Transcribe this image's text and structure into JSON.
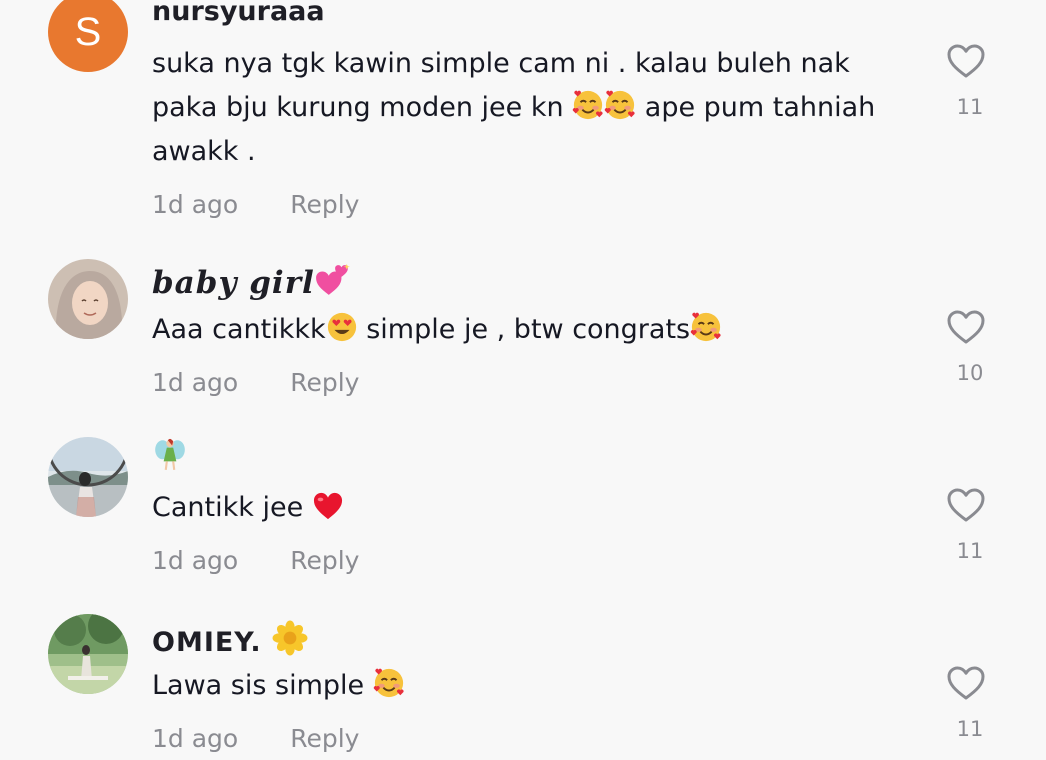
{
  "colors": {
    "background": "#f8f8f8",
    "text": "#161823",
    "muted": "#8a8b91",
    "avatar_letter_bg": "#e8782f"
  },
  "comments": [
    {
      "avatar_letter": "S",
      "username": "nursyuraaa",
      "text_line1": "suka nya tgk kawin simple cam ni . kalau buleh nak",
      "text_line2a": "paka bju kurung moden jee kn ",
      "text_line2b": " ape pum tahniah",
      "text_line3": "awakk .",
      "time": "1d ago",
      "reply": "Reply",
      "likes": "11",
      "icons": [
        "smiling-face-with-hearts-icon",
        "smiling-face-with-hearts-icon"
      ]
    },
    {
      "avatar": "profile-photo-hijab",
      "username": "baby girl",
      "username_icon": "two-hearts-icon",
      "text_a": "Aaa cantikkk",
      "text_b": " simple je , btw congrats",
      "time": "1d ago",
      "reply": "Reply",
      "likes": "10",
      "icons": [
        "heart-eyes-icon",
        "smiling-face-with-hearts-icon"
      ]
    },
    {
      "avatar": "profile-photo-outdoor",
      "username_icon": "fairy-icon",
      "text_a": "Cantikk jee ",
      "time": "1d ago",
      "reply": "Reply",
      "likes": "11",
      "icons": [
        "red-heart-icon"
      ]
    },
    {
      "avatar": "profile-photo-park",
      "username": "OMIEY.",
      "username_icon": "blossom-icon",
      "text_a": "Lawa sis simple ",
      "time": "1d ago",
      "reply": "Reply",
      "likes": "11",
      "icons": [
        "smiling-face-with-hearts-icon"
      ]
    }
  ]
}
